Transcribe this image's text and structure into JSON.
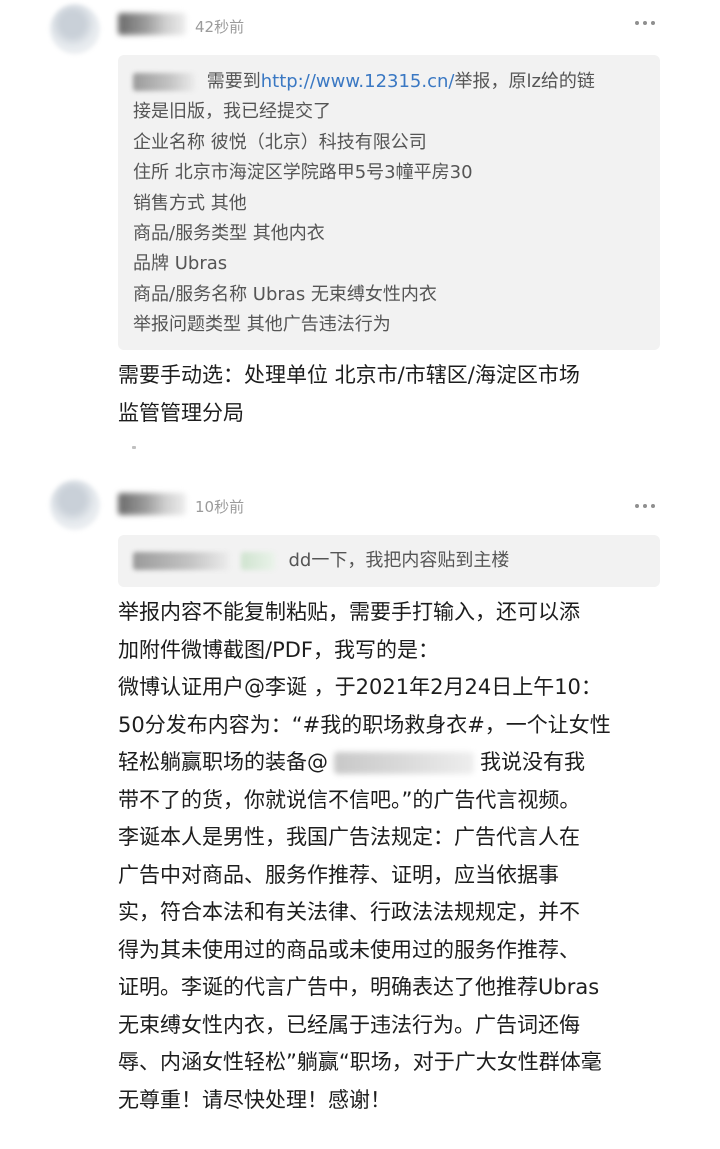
{
  "comments": [
    {
      "timestamp": "42秒前",
      "quote": {
        "lead": "需要到",
        "link": "http://www.12315.cn/",
        "after_link": "举报，原lz给的链",
        "lines": [
          "接是旧版，我已经提交了",
          "企业名称 彼悦（北京）科技有限公司",
          "住所 北京市海淀区学院路甲5号3幢平房30",
          "销售方式 其他",
          "商品/服务类型  其他内衣",
          "品牌 Ubras",
          "商品/服务名称  Ubras 无束缚女性内衣",
          "举报问题类型  其他广告违法行为"
        ]
      },
      "body_lines": [
        "需要手动选：处理单位 北京市/市辖区/海淀区市场",
        "监管管理分局"
      ]
    },
    {
      "timestamp": "10秒前",
      "quote": {
        "text": "dd一下，我把内容贴到主楼"
      },
      "body_lines": [
        "举报内容不能复制粘贴，需要手打输入，还可以添",
        "加附件微博截图/PDF，我写的是：",
        "微博认证用户@李诞 ，于2021年2月24日上午10：",
        "50分发布内容为：“#我的职场救身衣#，一个让女性",
        "我说没有我",
        "带不了的货，你就说信不信吧。”的广告代言视频。",
        "李诞本人是男性，我国广告法规定：广告代言人在",
        "广告中对商品、服务作推荐、证明，应当依据事",
        "实，符合本法和有关法律、行政法法规规定，并不",
        "得为其未使用过的商品或未使用过的服务作推荐、",
        "证明。李诞的代言广告中，明确表达了他推荐Ubras",
        "无束缚女性内衣，已经属于违法行为。广告词还侮",
        "辱、内涵女性轻松”躺赢“职场，对于广大女性群体毫",
        "无尊重！请尽快处理！感谢！"
      ],
      "mention_line_prefix": "轻松躺赢职场的装备@"
    }
  ]
}
